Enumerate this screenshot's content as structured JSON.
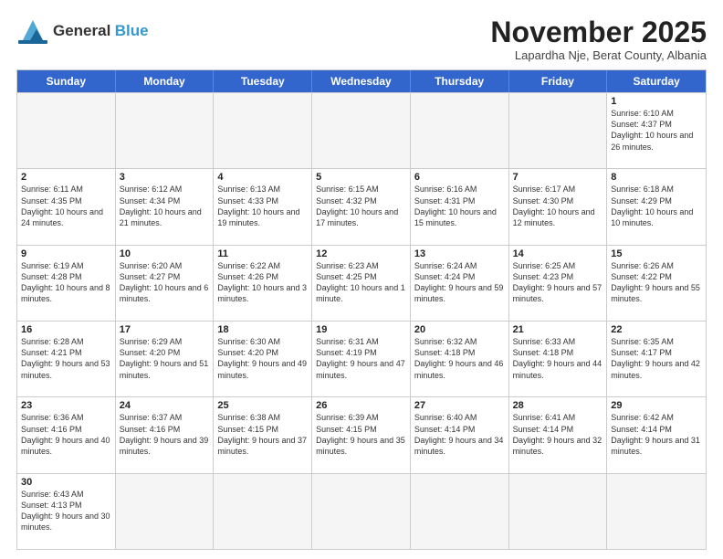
{
  "logo": {
    "line1": "General",
    "line2": "Blue"
  },
  "header": {
    "month": "November 2025",
    "location": "Lapardha Nje, Berat County, Albania"
  },
  "weekdays": [
    "Sunday",
    "Monday",
    "Tuesday",
    "Wednesday",
    "Thursday",
    "Friday",
    "Saturday"
  ],
  "weeks": [
    [
      {
        "day": "",
        "info": ""
      },
      {
        "day": "",
        "info": ""
      },
      {
        "day": "",
        "info": ""
      },
      {
        "day": "",
        "info": ""
      },
      {
        "day": "",
        "info": ""
      },
      {
        "day": "",
        "info": ""
      },
      {
        "day": "1",
        "info": "Sunrise: 6:10 AM\nSunset: 4:37 PM\nDaylight: 10 hours and 26 minutes."
      }
    ],
    [
      {
        "day": "2",
        "info": "Sunrise: 6:11 AM\nSunset: 4:35 PM\nDaylight: 10 hours and 24 minutes."
      },
      {
        "day": "3",
        "info": "Sunrise: 6:12 AM\nSunset: 4:34 PM\nDaylight: 10 hours and 21 minutes."
      },
      {
        "day": "4",
        "info": "Sunrise: 6:13 AM\nSunset: 4:33 PM\nDaylight: 10 hours and 19 minutes."
      },
      {
        "day": "5",
        "info": "Sunrise: 6:15 AM\nSunset: 4:32 PM\nDaylight: 10 hours and 17 minutes."
      },
      {
        "day": "6",
        "info": "Sunrise: 6:16 AM\nSunset: 4:31 PM\nDaylight: 10 hours and 15 minutes."
      },
      {
        "day": "7",
        "info": "Sunrise: 6:17 AM\nSunset: 4:30 PM\nDaylight: 10 hours and 12 minutes."
      },
      {
        "day": "8",
        "info": "Sunrise: 6:18 AM\nSunset: 4:29 PM\nDaylight: 10 hours and 10 minutes."
      }
    ],
    [
      {
        "day": "9",
        "info": "Sunrise: 6:19 AM\nSunset: 4:28 PM\nDaylight: 10 hours and 8 minutes."
      },
      {
        "day": "10",
        "info": "Sunrise: 6:20 AM\nSunset: 4:27 PM\nDaylight: 10 hours and 6 minutes."
      },
      {
        "day": "11",
        "info": "Sunrise: 6:22 AM\nSunset: 4:26 PM\nDaylight: 10 hours and 3 minutes."
      },
      {
        "day": "12",
        "info": "Sunrise: 6:23 AM\nSunset: 4:25 PM\nDaylight: 10 hours and 1 minute."
      },
      {
        "day": "13",
        "info": "Sunrise: 6:24 AM\nSunset: 4:24 PM\nDaylight: 9 hours and 59 minutes."
      },
      {
        "day": "14",
        "info": "Sunrise: 6:25 AM\nSunset: 4:23 PM\nDaylight: 9 hours and 57 minutes."
      },
      {
        "day": "15",
        "info": "Sunrise: 6:26 AM\nSunset: 4:22 PM\nDaylight: 9 hours and 55 minutes."
      }
    ],
    [
      {
        "day": "16",
        "info": "Sunrise: 6:28 AM\nSunset: 4:21 PM\nDaylight: 9 hours and 53 minutes."
      },
      {
        "day": "17",
        "info": "Sunrise: 6:29 AM\nSunset: 4:20 PM\nDaylight: 9 hours and 51 minutes."
      },
      {
        "day": "18",
        "info": "Sunrise: 6:30 AM\nSunset: 4:20 PM\nDaylight: 9 hours and 49 minutes."
      },
      {
        "day": "19",
        "info": "Sunrise: 6:31 AM\nSunset: 4:19 PM\nDaylight: 9 hours and 47 minutes."
      },
      {
        "day": "20",
        "info": "Sunrise: 6:32 AM\nSunset: 4:18 PM\nDaylight: 9 hours and 46 minutes."
      },
      {
        "day": "21",
        "info": "Sunrise: 6:33 AM\nSunset: 4:18 PM\nDaylight: 9 hours and 44 minutes."
      },
      {
        "day": "22",
        "info": "Sunrise: 6:35 AM\nSunset: 4:17 PM\nDaylight: 9 hours and 42 minutes."
      }
    ],
    [
      {
        "day": "23",
        "info": "Sunrise: 6:36 AM\nSunset: 4:16 PM\nDaylight: 9 hours and 40 minutes."
      },
      {
        "day": "24",
        "info": "Sunrise: 6:37 AM\nSunset: 4:16 PM\nDaylight: 9 hours and 39 minutes."
      },
      {
        "day": "25",
        "info": "Sunrise: 6:38 AM\nSunset: 4:15 PM\nDaylight: 9 hours and 37 minutes."
      },
      {
        "day": "26",
        "info": "Sunrise: 6:39 AM\nSunset: 4:15 PM\nDaylight: 9 hours and 35 minutes."
      },
      {
        "day": "27",
        "info": "Sunrise: 6:40 AM\nSunset: 4:14 PM\nDaylight: 9 hours and 34 minutes."
      },
      {
        "day": "28",
        "info": "Sunrise: 6:41 AM\nSunset: 4:14 PM\nDaylight: 9 hours and 32 minutes."
      },
      {
        "day": "29",
        "info": "Sunrise: 6:42 AM\nSunset: 4:14 PM\nDaylight: 9 hours and 31 minutes."
      }
    ],
    [
      {
        "day": "30",
        "info": "Sunrise: 6:43 AM\nSunset: 4:13 PM\nDaylight: 9 hours and 30 minutes."
      },
      {
        "day": "",
        "info": ""
      },
      {
        "day": "",
        "info": ""
      },
      {
        "day": "",
        "info": ""
      },
      {
        "day": "",
        "info": ""
      },
      {
        "day": "",
        "info": ""
      },
      {
        "day": "",
        "info": ""
      }
    ]
  ]
}
